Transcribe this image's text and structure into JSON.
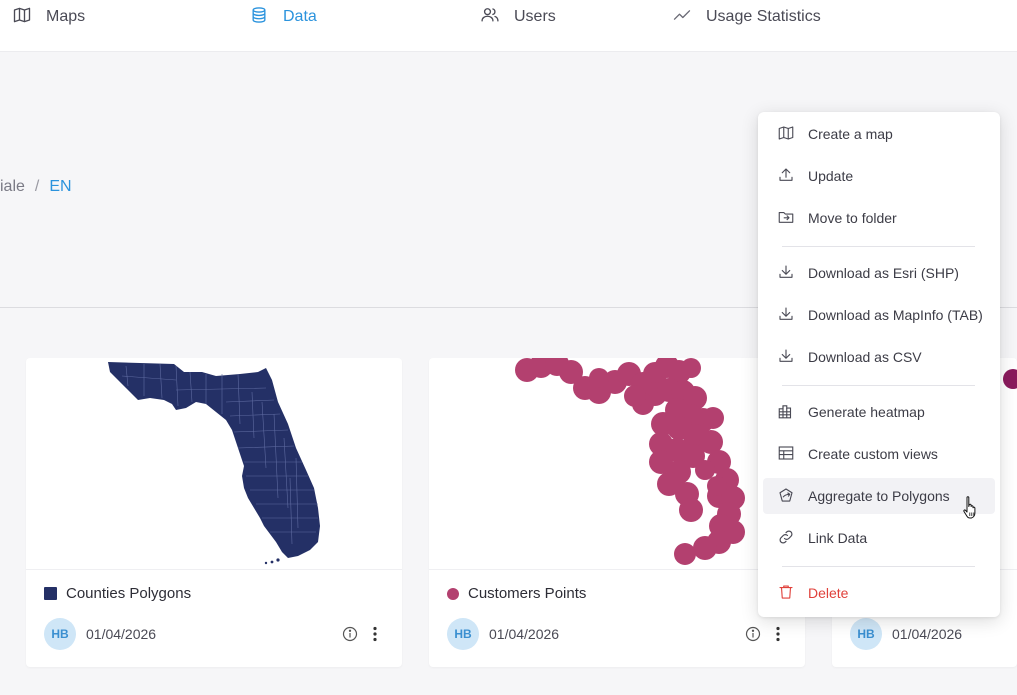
{
  "nav": {
    "items": [
      {
        "label": "Maps"
      },
      {
        "label": "Data"
      },
      {
        "label": "Users"
      },
      {
        "label": "Usage Statistics"
      }
    ]
  },
  "breadcrumb": {
    "parent": "iale",
    "separator": "/",
    "current": "EN"
  },
  "cards": [
    {
      "title": "Counties Polygons",
      "avatar": "HB",
      "date": "01/04/2026",
      "swatch_color": "#243066"
    },
    {
      "title": "Customers Points",
      "avatar": "HB",
      "date": "01/04/2026",
      "swatch_color": "#b3406f"
    },
    {
      "title": "",
      "avatar": "HB",
      "date": "01/04/2026",
      "swatch_color": "#8a1a5c"
    }
  ],
  "menu": {
    "items": [
      {
        "label": "Create a map",
        "icon": "map-icon"
      },
      {
        "label": "Update",
        "icon": "upload-icon"
      },
      {
        "label": "Move to folder",
        "icon": "folder-move-icon"
      },
      {
        "label": "Download as Esri (SHP)",
        "icon": "download-icon"
      },
      {
        "label": "Download as MapInfo (TAB)",
        "icon": "download-icon"
      },
      {
        "label": "Download as CSV",
        "icon": "download-icon"
      },
      {
        "label": "Generate heatmap",
        "icon": "heatmap-grid-icon"
      },
      {
        "label": "Create custom views",
        "icon": "table-icon"
      },
      {
        "label": "Aggregate to Polygons",
        "icon": "aggregate-icon"
      },
      {
        "label": "Link Data",
        "icon": "link-icon"
      },
      {
        "label": "Delete",
        "icon": "trash-icon"
      }
    ]
  },
  "colors": {
    "accent": "#2b93dd",
    "polygons": "#243066",
    "points": "#b3406f",
    "danger": "#e0413b"
  }
}
